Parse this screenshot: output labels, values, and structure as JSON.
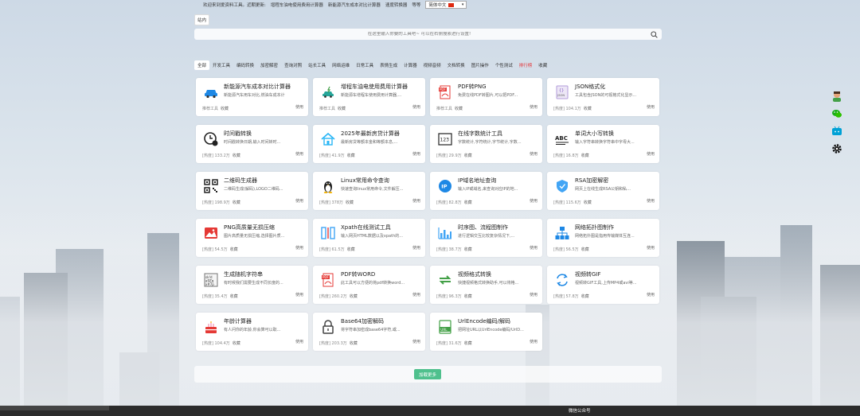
{
  "notice": {
    "welcome": "欢迎来到爱资料工具。近期更新:",
    "links": [
      "增程车油电使用费用计算器",
      "新能源汽车成本对比计算器",
      "速度转换器",
      "等等"
    ]
  },
  "language": {
    "selected": "简体中文"
  },
  "search": {
    "tabs": [
      "站内",
      "",
      "",
      "",
      "",
      "",
      "",
      "",
      "",
      "",
      "",
      "",
      "",
      ""
    ],
    "placeholder": "在这里输入你要的工具吧~ 可以在右侧搜索进行设置!"
  },
  "categories": [
    "全部",
    "开发工具",
    "编码转换",
    "加密解密",
    "查询对照",
    "站长工具",
    "网络运维",
    "日常工具",
    "表情生成",
    "计算器",
    "视频音频",
    "文档转换",
    "图片操作",
    "个性测试",
    "排行榜",
    "收藏"
  ],
  "active_category": "全部",
  "hot_category": "排行榜",
  "tools": [
    {
      "title": "新能源汽车成本对比计算器",
      "desc": "新能源汽车用车对比,燃油车成本计",
      "meta": "推荐工具",
      "fav": "收藏",
      "use": "使用",
      "icon": "car-icon",
      "color": "#1e88e5"
    },
    {
      "title": "增程车油电使用费用计算器",
      "desc": "新能源车增程车使用费用计算器,...",
      "meta": "推荐工具",
      "fav": "收藏",
      "use": "使用",
      "icon": "ev-car-icon",
      "color": "#26a69a"
    },
    {
      "title": "PDF转PNG",
      "desc": "免费在线PDF转图片,可以把PDF...",
      "meta": "推荐工具",
      "fav": "收藏",
      "use": "使用",
      "icon": "pdf-icon",
      "color": "#e53935"
    },
    {
      "title": "JSON格式化",
      "desc": "工具包含JSON的可视格式化显示...",
      "meta": "[热度] 104.1万",
      "fav": "收藏",
      "use": "使用",
      "icon": "json-icon",
      "color": "#7e57c2"
    },
    {
      "title": "时间戳转换",
      "desc": "时间戳转换日期,输入时间转时...",
      "meta": "[热度] 133.2万",
      "fav": "收藏",
      "use": "使用",
      "icon": "clock-icon",
      "color": "#212121"
    },
    {
      "title": "2025年最新房贷计算器",
      "desc": "最新房贷等额本金和等额本息,...",
      "meta": "[热度] 41.9万",
      "fav": "收藏",
      "use": "使用",
      "icon": "house-icon",
      "color": "#29b6f6"
    },
    {
      "title": "在线字数统计工具",
      "desc": "字数统计,字符统计,字节统计,字数...",
      "meta": "[热度] 29.9万",
      "fav": "收藏",
      "use": "使用",
      "icon": "count-icon",
      "color": "#212121"
    },
    {
      "title": "单词大小写转换",
      "desc": "输入字符串转换字符串中字母大...",
      "meta": "[热度] 16.8万",
      "fav": "收藏",
      "use": "使用",
      "icon": "abc-icon",
      "color": "#212121"
    },
    {
      "title": "二维码生成器",
      "desc": "二维码生成(解码),LOGO二维码...",
      "meta": "[热度] 198.9万",
      "fav": "收藏",
      "use": "使用",
      "icon": "qrcode-icon",
      "color": "#212121"
    },
    {
      "title": "Linux常用命令查询",
      "desc": "快速查询linux常用命令,文件解压...",
      "meta": "[热度] 378万",
      "fav": "收藏",
      "use": "使用",
      "icon": "linux-icon",
      "color": "#212121"
    },
    {
      "title": "IP域名地址查询",
      "desc": "输入IP或域名,来查询对应IP的地...",
      "meta": "[热度] 82.8万",
      "fav": "收藏",
      "use": "使用",
      "icon": "ip-icon",
      "color": "#1e88e5"
    },
    {
      "title": "RSA加密解密",
      "desc": "网页上在线生成RSA公钥和私...",
      "meta": "[热度] 115.6万",
      "fav": "收藏",
      "use": "使用",
      "icon": "shield-icon",
      "color": "#42a5f5"
    },
    {
      "title": "PNG高质量无损压缩",
      "desc": "图片高质量无损压缩,选择图片质...",
      "meta": "[热度] 54.5万",
      "fav": "收藏",
      "use": "使用",
      "icon": "image-icon",
      "color": "#e53935"
    },
    {
      "title": "Xpath在线测试工具",
      "desc": "输入网页HTML数据以及xpath的...",
      "meta": "[热度] 61.5万",
      "fav": "收藏",
      "use": "使用",
      "icon": "xpath-icon",
      "color": "#42a5f5"
    },
    {
      "title": "时序图、流程图制作",
      "desc": "进行逻辑交互比较复杂情况下,...",
      "meta": "[热度] 38.7万",
      "fav": "收藏",
      "use": "使用",
      "icon": "chart-icon",
      "color": "#42a5f5"
    },
    {
      "title": "网络拓扑图制作",
      "desc": "网络拓扑图是指用传输媒体互连...",
      "meta": "[热度] 56.5万",
      "fav": "收藏",
      "use": "使用",
      "icon": "topology-icon",
      "color": "#1e88e5"
    },
    {
      "title": "生成随机字符串",
      "desc": "有时候我们需要生成不同长度的...",
      "meta": "[热度] 35.4万",
      "fav": "收藏",
      "use": "使用",
      "icon": "random-icon",
      "color": "#757575"
    },
    {
      "title": "PDF转WORD",
      "desc": "此工具可以方便的将pdf转换word...",
      "meta": "[热度] 260.2万",
      "fav": "收藏",
      "use": "使用",
      "icon": "pdf-word-icon",
      "color": "#e53935"
    },
    {
      "title": "视频格式转换",
      "desc": "快捷视频格式转换助手,可以将格...",
      "meta": "[热度] 96.3万",
      "fav": "收藏",
      "use": "使用",
      "icon": "convert-icon",
      "color": "#43a047"
    },
    {
      "title": "视频转GIF",
      "desc": "视频转GIF工具,上传MP4或avi等...",
      "meta": "[热度] 57.8万",
      "fav": "收藏",
      "use": "使用",
      "icon": "gif-icon",
      "color": "#1e88e5"
    },
    {
      "title": "年龄计算器",
      "desc": "有人问你的年龄,你会算可以取...",
      "meta": "[热度] 104.4万",
      "fav": "收藏",
      "use": "使用",
      "icon": "cake-icon",
      "color": "#e53935"
    },
    {
      "title": "Base64加密解码",
      "desc": "将字符串加密成base64字符,或...",
      "meta": "[热度] 203.3万",
      "fav": "收藏",
      "use": "使用",
      "icon": "lock-icon",
      "color": "#424242"
    },
    {
      "title": "UrlEncode编码/解码",
      "desc": "把网址URL以UrlEncode编码/UrlD...",
      "meta": "[热度] 31.6万",
      "fav": "收藏",
      "use": "使用",
      "icon": "url-icon",
      "color": "#43a047"
    }
  ],
  "load_more": "加载更多",
  "footer": {
    "label": "微信公众号"
  }
}
